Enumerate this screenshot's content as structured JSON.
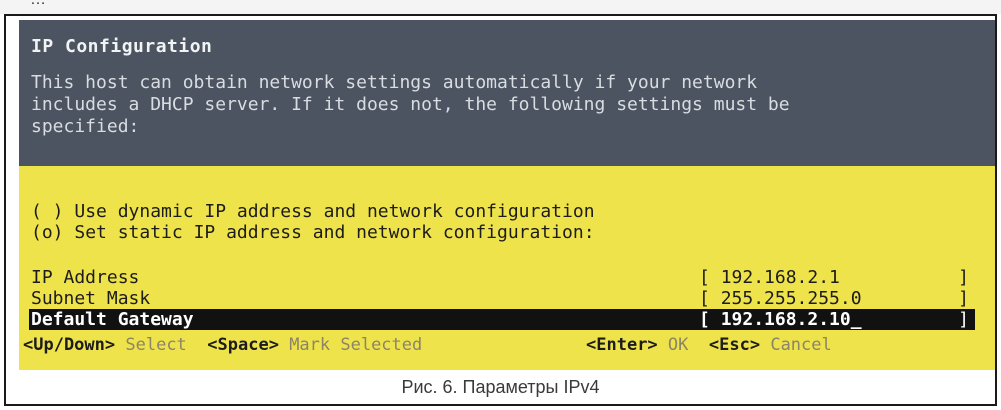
{
  "header": {
    "title": "IP Configuration",
    "description": "This host can obtain network settings automatically if your network\nincludes a DHCP server. If it does not, the following settings must be\nspecified:"
  },
  "options": [
    {
      "marker": "( )",
      "label": "Use dynamic IP address and network configuration",
      "selected": false
    },
    {
      "marker": "(o)",
      "label": "Set static IP address and network configuration:",
      "selected": true
    }
  ],
  "fields": [
    {
      "label": "IP Address",
      "value": "192.168.2.1",
      "focused": false
    },
    {
      "label": "Subnet Mask",
      "value": "255.255.255.0",
      "focused": false
    },
    {
      "label": "Default Gateway",
      "value": "192.168.2.10_",
      "focused": true
    }
  ],
  "bracket_open": "[",
  "bracket_close": "]",
  "footer": {
    "key_updown": "<Up/Down>",
    "act_updown": "Select",
    "key_space": "<Space>",
    "act_space": "Mark Selected",
    "key_enter": "<Enter>",
    "act_enter": "OK",
    "key_esc": "<Esc>",
    "act_esc": "Cancel"
  },
  "caption": "Рис. 6. Параметры IPv4",
  "colors": {
    "header_bg": "#4b5460",
    "body_bg": "#efe34b",
    "highlight_bg": "#111111"
  }
}
